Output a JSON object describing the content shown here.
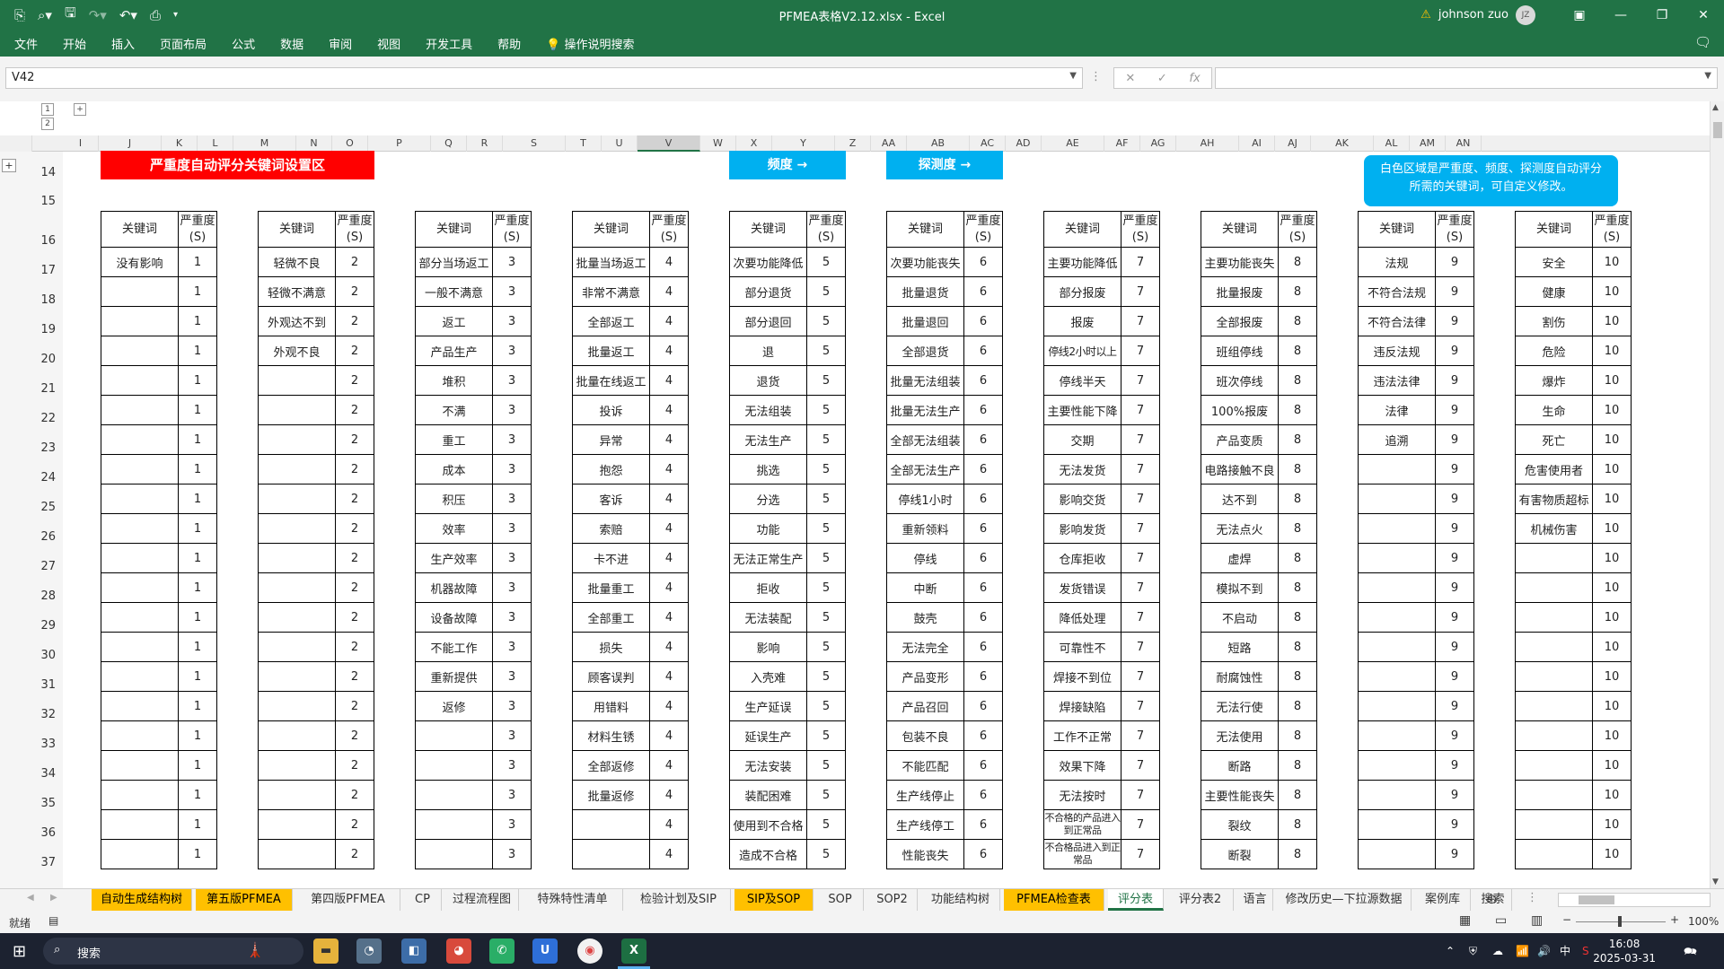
{
  "window": {
    "title": "PFMEA表格V2.12.xlsx  -  Excel",
    "user": "johnson zuo",
    "user_initials": "JZ"
  },
  "ribbon_tabs": [
    "文件",
    "开始",
    "插入",
    "页面布局",
    "公式",
    "数据",
    "审阅",
    "视图",
    "开发工具",
    "帮助",
    "操作说明搜索"
  ],
  "formula_bar": {
    "name_box": "V42",
    "formula": ""
  },
  "outline_levels": [
    "1",
    "2"
  ],
  "columns": [
    "I",
    "J",
    "K",
    "L",
    "M",
    "N",
    "O",
    "P",
    "Q",
    "R",
    "S",
    "T",
    "U",
    "V",
    "W",
    "X",
    "Y",
    "Z",
    "AA",
    "AB",
    "AC",
    "AD",
    "AE",
    "AF",
    "AG",
    "AH",
    "AI",
    "AJ",
    "AK",
    "AL",
    "AM",
    "AN"
  ],
  "rows": [
    "14",
    "15",
    "16",
    "17",
    "18",
    "19",
    "20",
    "21",
    "22",
    "23",
    "24",
    "25",
    "26",
    "27",
    "28",
    "29",
    "30",
    "31",
    "32",
    "33",
    "34",
    "35",
    "36",
    "37"
  ],
  "banner": "严重度自动评分关键词设置区",
  "freq_button": "频度 →",
  "detect_button": "探测度 →",
  "note": "白色区域是严重度、频度、探测度自动评分所需的关键词，可自定义修改。",
  "header_keyword": "关键词",
  "header_severity": "严重度(S)",
  "tables": [
    {
      "score": "1",
      "keywords": [
        "没有影响",
        "",
        "",
        "",
        "",
        "",
        "",
        "",
        "",
        "",
        "",
        "",
        "",
        "",
        "",
        "",
        "",
        "",
        "",
        "",
        ""
      ]
    },
    {
      "score": "2",
      "keywords": [
        "轻微不良",
        "轻微不满意",
        "外观达不到",
        "外观不良",
        "",
        "",
        "",
        "",
        "",
        "",
        "",
        "",
        "",
        "",
        "",
        "",
        "",
        "",
        "",
        "",
        ""
      ]
    },
    {
      "score": "3",
      "keywords": [
        "部分当场返工",
        "一般不满意",
        "返工",
        "产品生产",
        "堆积",
        "不满",
        "重工",
        "成本",
        "积压",
        "效率",
        "生产效率",
        "机器故障",
        "设备故障",
        "不能工作",
        "重新提供",
        "返修",
        "",
        "",
        "",
        "",
        ""
      ]
    },
    {
      "score": "4",
      "keywords": [
        "批量当场返工",
        "非常不满意",
        "全部返工",
        "批量返工",
        "批量在线返工",
        "投诉",
        "异常",
        "抱怨",
        "客诉",
        "索赔",
        "卡不进",
        "批量重工",
        "全部重工",
        "损失",
        "顾客误判",
        "用错料",
        "材料生锈",
        "全部返修",
        "批量返修",
        "",
        ""
      ]
    },
    {
      "score": "5",
      "keywords": [
        "次要功能降低",
        "部分退货",
        "部分退回",
        "退",
        "退货",
        "无法组装",
        "无法生产",
        "挑选",
        "分选",
        "功能",
        "无法正常生产",
        "拒收",
        "无法装配",
        "影响",
        "入壳难",
        "生产延误",
        "延误生产",
        "无法安装",
        "装配困难",
        "使用到不合格",
        "造成不合格"
      ]
    },
    {
      "score": "6",
      "keywords": [
        "次要功能丧失",
        "批量退货",
        "批量退回",
        "全部退货",
        "批量无法组装",
        "批量无法生产",
        "全部无法组装",
        "全部无法生产",
        "停线1小时",
        "重新领料",
        "停线",
        "中断",
        "鼓壳",
        "无法完全",
        "产品变形",
        "产品召回",
        "包装不良",
        "不能匹配",
        "生产线停止",
        "生产线停工",
        "性能丧失"
      ]
    },
    {
      "score": "7",
      "keywords": [
        "主要功能降低",
        "部分报废",
        "报废",
        "停线2小时以上",
        "停线半天",
        "主要性能下降",
        "交期",
        "无法发货",
        "影响交货",
        "影响发货",
        "仓库拒收",
        "发货错误",
        "降低处理",
        "可靠性不",
        "焊接不到位",
        "焊接缺陷",
        "工作不正常",
        "效果下降",
        "无法按时",
        "不合格的产品进入到正常品",
        "不合格品进入到正常品"
      ]
    },
    {
      "score": "8",
      "keywords": [
        "主要功能丧失",
        "批量报废",
        "全部报废",
        "班组停线",
        "班次停线",
        "100%报废",
        "产品变质",
        "电路接触不良",
        "达不到",
        "无法点火",
        "虚焊",
        "模拟不到",
        "不启动",
        "短路",
        "耐腐蚀性",
        "无法行使",
        "无法使用",
        "断路",
        "主要性能丧失",
        "裂纹",
        "断裂"
      ]
    },
    {
      "score": "9",
      "keywords": [
        "法规",
        "不符合法规",
        "不符合法律",
        "违反法规",
        "违法法律",
        "法律",
        "追溯",
        "",
        "",
        "",
        "",
        "",
        "",
        "",
        "",
        "",
        "",
        "",
        "",
        "",
        ""
      ]
    },
    {
      "score": "10",
      "keywords": [
        "安全",
        "健康",
        "割伤",
        "危险",
        "爆炸",
        "生命",
        "死亡",
        "危害使用者",
        "有害物质超标",
        "机械伤害",
        "",
        "",
        "",
        "",
        "",
        "",
        "",
        "",
        "",
        "",
        ""
      ]
    }
  ],
  "sheet_tabs": [
    "自动生成结构树",
    "第五版PFMEA",
    "第四版PFMEA",
    "CP",
    "过程流程图",
    "特殊特性清单",
    "检验计划及SIP",
    "SIP及SOP",
    "SOP",
    "SOP2",
    "功能结构树",
    "PFMEA检查表",
    "评分表",
    "评分表2",
    "语言",
    "修改历史—下拉源数据",
    "案例库",
    "搜索"
  ],
  "status": {
    "ready": "就绪",
    "zoom": "100%"
  },
  "taskbar": {
    "search": "搜索",
    "time": "16:08",
    "date": "2025-03-31",
    "ime": "中"
  },
  "colors": {
    "excel_green": "#217346",
    "banner_red": "#ff0000",
    "button_blue": "#00b0f0",
    "tab_yellow": "#ffc000"
  }
}
